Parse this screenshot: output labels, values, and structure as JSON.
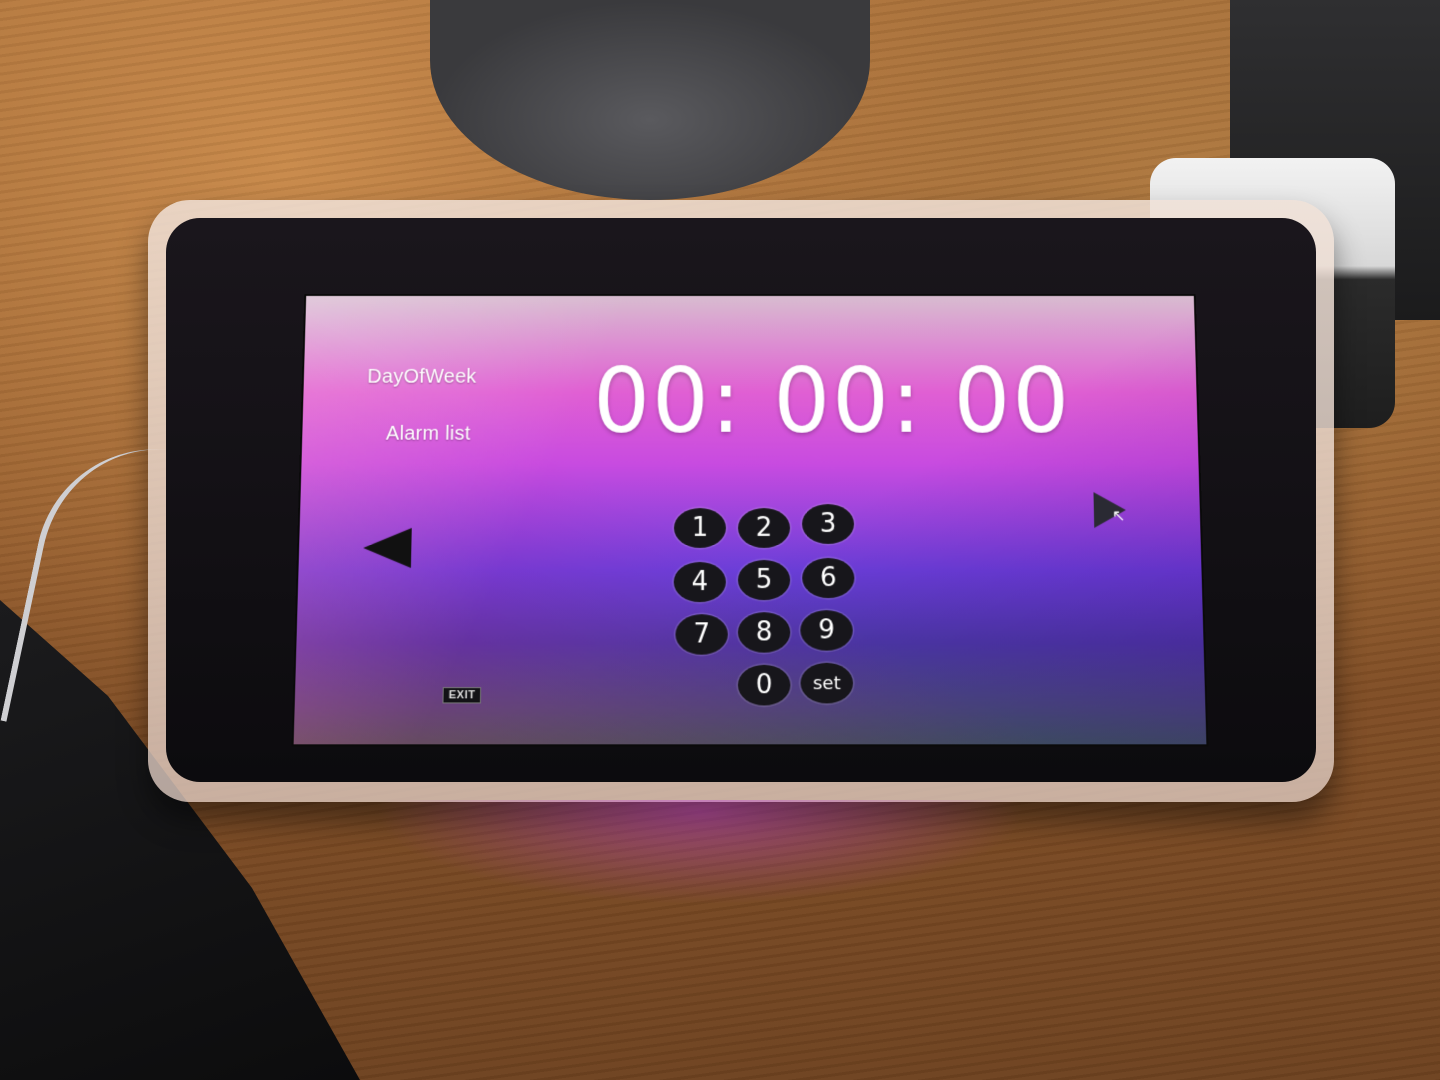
{
  "screen": {
    "day_of_week_label": "DayOfWeek",
    "alarm_list_label": "Alarm list",
    "clock_time": "00: 00: 00",
    "exit_label": "EXIT"
  },
  "keypad": {
    "keys": [
      "1",
      "2",
      "3",
      "4",
      "5",
      "6",
      "7",
      "8",
      "9",
      "0",
      "set"
    ]
  },
  "navigation": {
    "left_icon": "triangle-left-icon",
    "right_icon": "triangle-right-icon",
    "cursor_icon": "mouse-pointer-icon"
  },
  "colors": {
    "screen_top": "#e05fd3",
    "screen_bottom": "#4b3aa6",
    "key_background": "#17161b"
  }
}
